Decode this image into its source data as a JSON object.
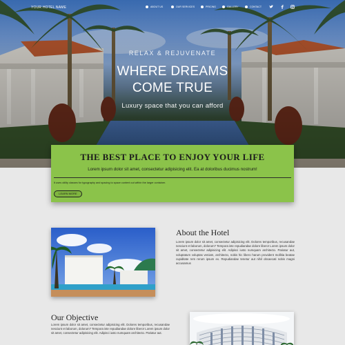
{
  "nav": {
    "brand": "YOUR HOTEL NAME",
    "items": [
      {
        "label": "ABOUT US",
        "icon": "info-icon"
      },
      {
        "label": "OUR SERVICES",
        "icon": "services-icon"
      },
      {
        "label": "PRICING",
        "icon": "pricing-icon"
      },
      {
        "label": "GALLERY",
        "icon": "gallery-icon"
      },
      {
        "label": "CONTACT",
        "icon": "contact-icon"
      }
    ],
    "social": [
      "twitter-icon",
      "facebook-icon",
      "instagram-icon"
    ]
  },
  "hero": {
    "kicker": "RELAX & REJUVENATE",
    "headline_line1": "WHERE DREAMS",
    "headline_line2": "COME TRUE",
    "tagline": "Luxury space that you can afford"
  },
  "card": {
    "title": "THE BEST PLACE TO ENJOY YOUR LIFE",
    "subtitle": "Lorem ipsum dolor sit amet, consectetur adipisicing elit. Ea at doloribus ducimus nostrum!",
    "note": "It uses utility classes for typography and spacing to space content out within the larger container.",
    "button": "LEARN MORE"
  },
  "about": {
    "title": "About the Hotel",
    "text": "Lorem ipsum dolor sit amet, consectetur adipisicing elit. Dolores temporibus, recusandae nesciunt et laborum, dolorum? Tempora iste repudiandae dolore libero! Lorem ipsum dolor sit amet, consectetur adipisicing elit. Adipisci iusto numquam architecto. Pariatur aut, voluptatum voluptas veniam, architecto, nobis hic libero harum provident mollitia beatae cupiditate rem rerum ipsum ex. Repudiandae tenetur aut nihil obcaecati nobis magni accusamus"
  },
  "objective": {
    "title": "Our Objective",
    "text": "Lorem ipsum dolor sit amet, consectetur adipisicing elit. Dolores temporibus, recusandae nesciunt et laborum, dolorum? Tempora iste repudiandae dolore libero! Lorem ipsum dolor sit amet, consectetur adipisicing elit. Adipisci iusto numquam architecto. Pariatur aut."
  },
  "colors": {
    "accent_green": "#8bc34a",
    "page_bg": "#e8e8e8"
  }
}
